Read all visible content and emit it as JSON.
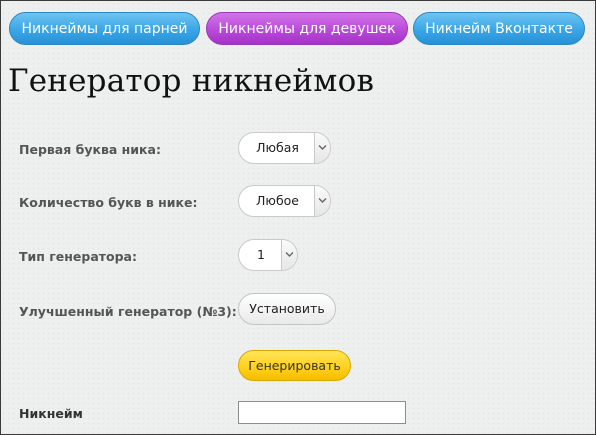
{
  "nav": {
    "boys": "Никнеймы для парней",
    "girls": "Никнеймы для девушек",
    "vk": "Никнейм Вконтакте"
  },
  "page_title": "Генератор никнеймов",
  "form": {
    "first_letter": {
      "label": "Первая буква ника:",
      "value": "Любая"
    },
    "letter_count": {
      "label": "Количество букв в нике:",
      "value": "Любое"
    },
    "generator_type": {
      "label": "Тип генератора:",
      "value": "1"
    },
    "improved": {
      "label": "Улучшенный генератор (№3):",
      "button": "Установить"
    },
    "generate_button": "Генерировать",
    "nickname": {
      "label": "Никнейм",
      "value": ""
    }
  },
  "colors": {
    "nav_blue": "#3aa6e6",
    "nav_purple": "#b94bd9",
    "generate_yellow": "#ffd21f"
  },
  "icons": {
    "dropdown": "chevron-down-icon"
  }
}
